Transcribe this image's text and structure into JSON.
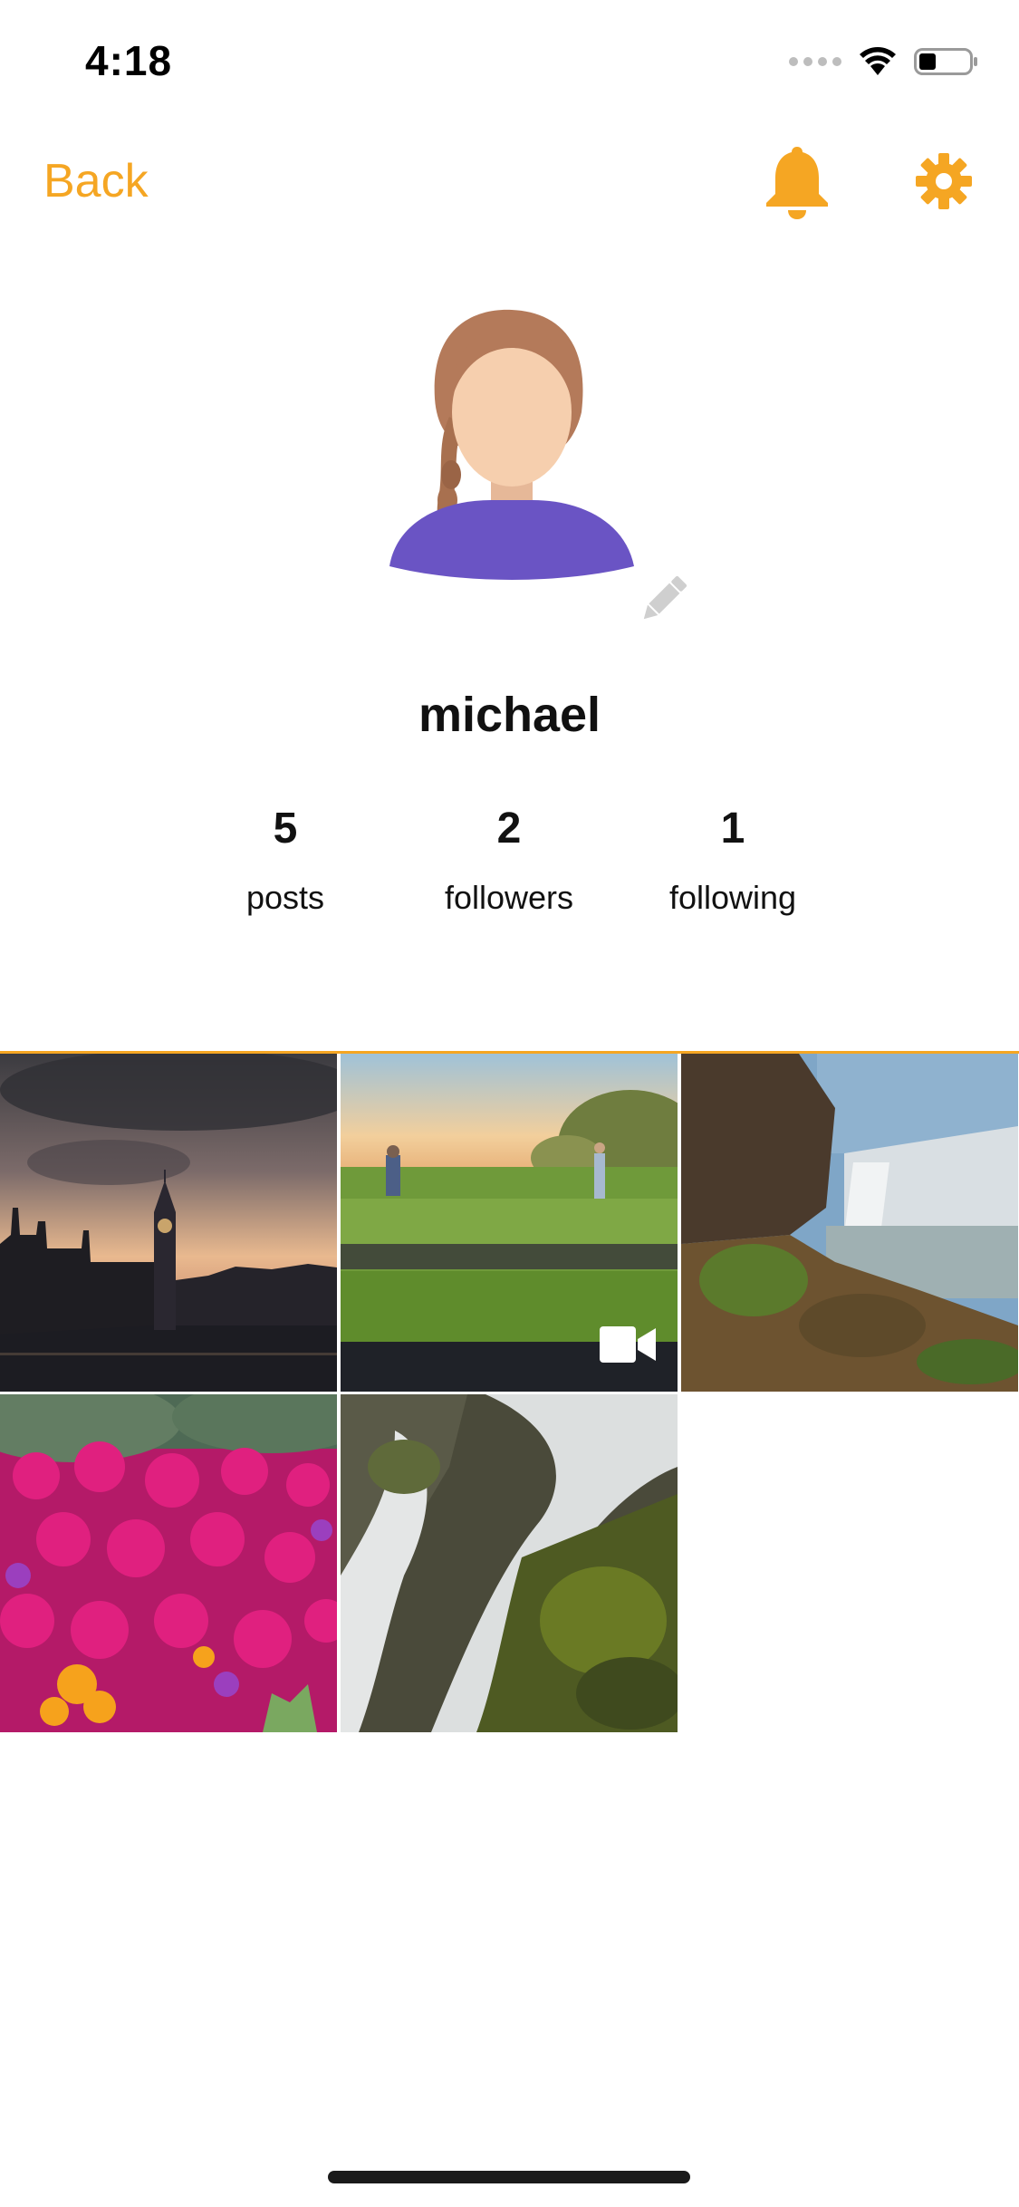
{
  "status_bar": {
    "time": "4:18",
    "icons": [
      "signal-dots-icon",
      "wifi-icon",
      "battery-icon"
    ]
  },
  "nav": {
    "back_label": "Back",
    "icons": [
      "bell-icon",
      "gear-icon"
    ],
    "accent_color": "#f5a623"
  },
  "profile": {
    "username": "michael",
    "avatar_icon": "avatar-girl-icon",
    "edit_icon": "pencil-icon"
  },
  "stats": [
    {
      "value": "5",
      "label": "posts"
    },
    {
      "value": "2",
      "label": "followers"
    },
    {
      "value": "1",
      "label": "following"
    }
  ],
  "grid": {
    "photos": [
      {
        "subject": "big-ben-skyline",
        "type": "photo"
      },
      {
        "subject": "field-people",
        "type": "video"
      },
      {
        "subject": "waterfall-cliff",
        "type": "photo"
      },
      {
        "subject": "pink-flowers",
        "type": "photo"
      },
      {
        "subject": "mossy-waterfall",
        "type": "photo"
      }
    ],
    "video_icon": "video-camera-icon"
  }
}
